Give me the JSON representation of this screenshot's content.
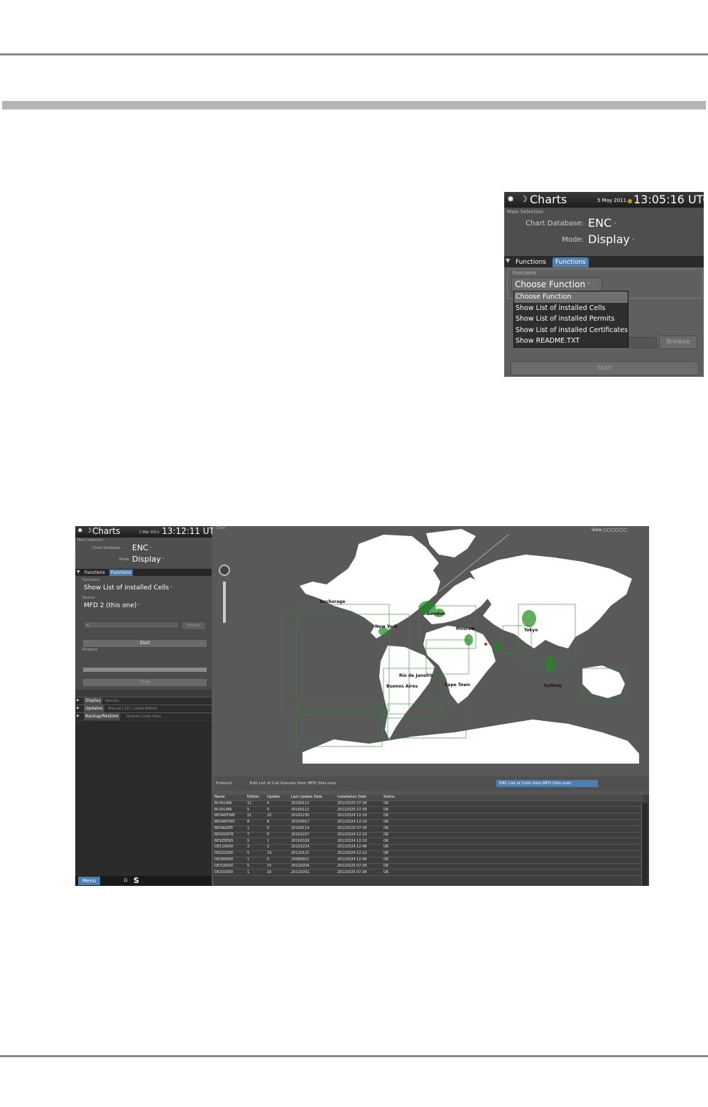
{
  "shot1": {
    "title": "Charts",
    "date": "5 May 2011",
    "time": "13:05:16 UTC",
    "main_selection_label": "Main Selection",
    "chart_db_label": "Chart Database:",
    "chart_db_value": "ENC",
    "mode_label": "Mode:",
    "mode_value": "Display",
    "tab_functions_1": "Functions",
    "tab_functions_2": "Functions",
    "functions_small": "Functions",
    "choose_function": "Choose Function",
    "menu_items": [
      "Choose Function",
      "Show List of installed Cells",
      "Show List of installed Permits",
      "Show List of installed Certificates",
      "Show README.TXT"
    ],
    "browse_label": "Browse",
    "start_label": "Start"
  },
  "shot2": {
    "title": "Charts",
    "date": "1 Mar 2011",
    "time": "13:12:11 UTC",
    "main_selection_label": "Main Selection",
    "chart_db_label": "Chart Database:",
    "chart_db_value": "ENC",
    "mode_label": "Mode:",
    "mode_value": "Display",
    "tab_functions_1": "Functions",
    "tab_functions_2": "Functions",
    "functions_small": "Functions",
    "function_value": "Show List of installed Cells",
    "source_small": "Source",
    "source_value": "MFD 2 (this one)",
    "slider_text": "<",
    "browse_label": "Browse",
    "start_label": "Start",
    "progress_small": "Progress",
    "stop_label": "Stop",
    "sections": [
      {
        "title": "Display",
        "sub": "Options"
      },
      {
        "title": "Updates",
        "sub": "Manual | CD | Latest Edition"
      },
      {
        "title": "Backup/Restore",
        "sub": "Restore | User Data"
      }
    ],
    "menu_label": "Menu",
    "footer_s": "S",
    "chart_tab": "Chart",
    "view_label": "View",
    "cities": [
      "Anchorage",
      "London",
      "Moscow",
      "New York",
      "Tokyo",
      "Rio de Janeiro",
      "Buenos Aires",
      "Cape Town",
      "Sydney"
    ],
    "filter_left": "Protocol",
    "filter_mid": "Edit List of Cell licenses from MFD (this one)",
    "filter_selected": "ENC List of Cells from MFD (this one)",
    "columns": [
      "Name",
      "Edition",
      "Update",
      "Last Update Date",
      "Installation Date",
      "Status"
    ],
    "rows": [
      [
        "BC4VLINK",
        "11",
        "0",
        "20100112",
        "20110325 07:39",
        "OK"
      ],
      [
        "BC4VLINK",
        "5",
        "0",
        "20100112",
        "20110325 07:39",
        "OK"
      ],
      [
        "BESANTWN",
        "11",
        "10",
        "20101230",
        "20110324 12:19",
        "OK"
      ],
      [
        "BESANTWZ",
        "8",
        "8",
        "20100917",
        "20110324 12:19",
        "OK"
      ],
      [
        "BESAGATE",
        "1",
        "0",
        "20100114",
        "20110325 07:39",
        "OK"
      ],
      [
        "BESOOSTE",
        "7",
        "0",
        "20101227",
        "20110324 12:19",
        "OK"
      ],
      [
        "BESZEENS",
        "5",
        "1",
        "20100329",
        "20110324 12:19",
        "OK"
      ],
      [
        "DE110000",
        "2",
        "2",
        "20101224",
        "20110324 12:46",
        "OK"
      ],
      [
        "DE221000",
        "5",
        "19",
        "20110121",
        "20110324 12:12",
        "OK"
      ],
      [
        "DE260000",
        "1",
        "0",
        "20060921",
        "20110324 12:46",
        "OK"
      ],
      [
        "DE316000",
        "5",
        "15",
        "20110204",
        "20110325 07:39",
        "OK"
      ],
      [
        "DE333000",
        "1",
        "10",
        "20110201",
        "20110325 07:39",
        "OK"
      ]
    ]
  }
}
